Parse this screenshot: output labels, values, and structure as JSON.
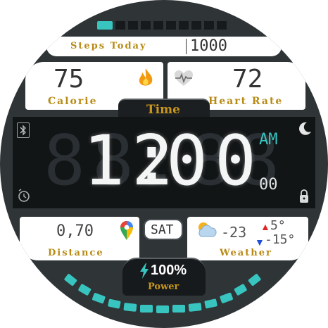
{
  "steps": {
    "label": "Steps Today",
    "value": "1000",
    "progress_bars_filled": 1,
    "progress_bars_total": 8
  },
  "calorie": {
    "value": "75",
    "label": "Calorie",
    "icon": "flame-icon"
  },
  "heart": {
    "value": "72",
    "label": "Heart Rate",
    "icon": "heart-monitor-icon"
  },
  "time": {
    "label": "Time",
    "hours": "12",
    "minutes": "00",
    "ampm": "AM",
    "seconds": "00",
    "ghost": "88:88"
  },
  "distance": {
    "value": "0,70",
    "label": "Distance",
    "icon": "map-pin-icon"
  },
  "day": {
    "value": "SAT"
  },
  "weather": {
    "temp": "-23",
    "label": "Weather",
    "high": "5°",
    "low": "-15°",
    "icon": "partly-cloudy-icon"
  },
  "power": {
    "value": "100%",
    "label": "Power",
    "icon": "lightning-icon",
    "segments_total": 14,
    "segments_filled": 14
  },
  "colors": {
    "accent": "#38c5bf",
    "gold": "#b88a14",
    "bezel": "#2f3437",
    "display": "#121516",
    "up": "#e02424",
    "down": "#1f4ed8"
  }
}
